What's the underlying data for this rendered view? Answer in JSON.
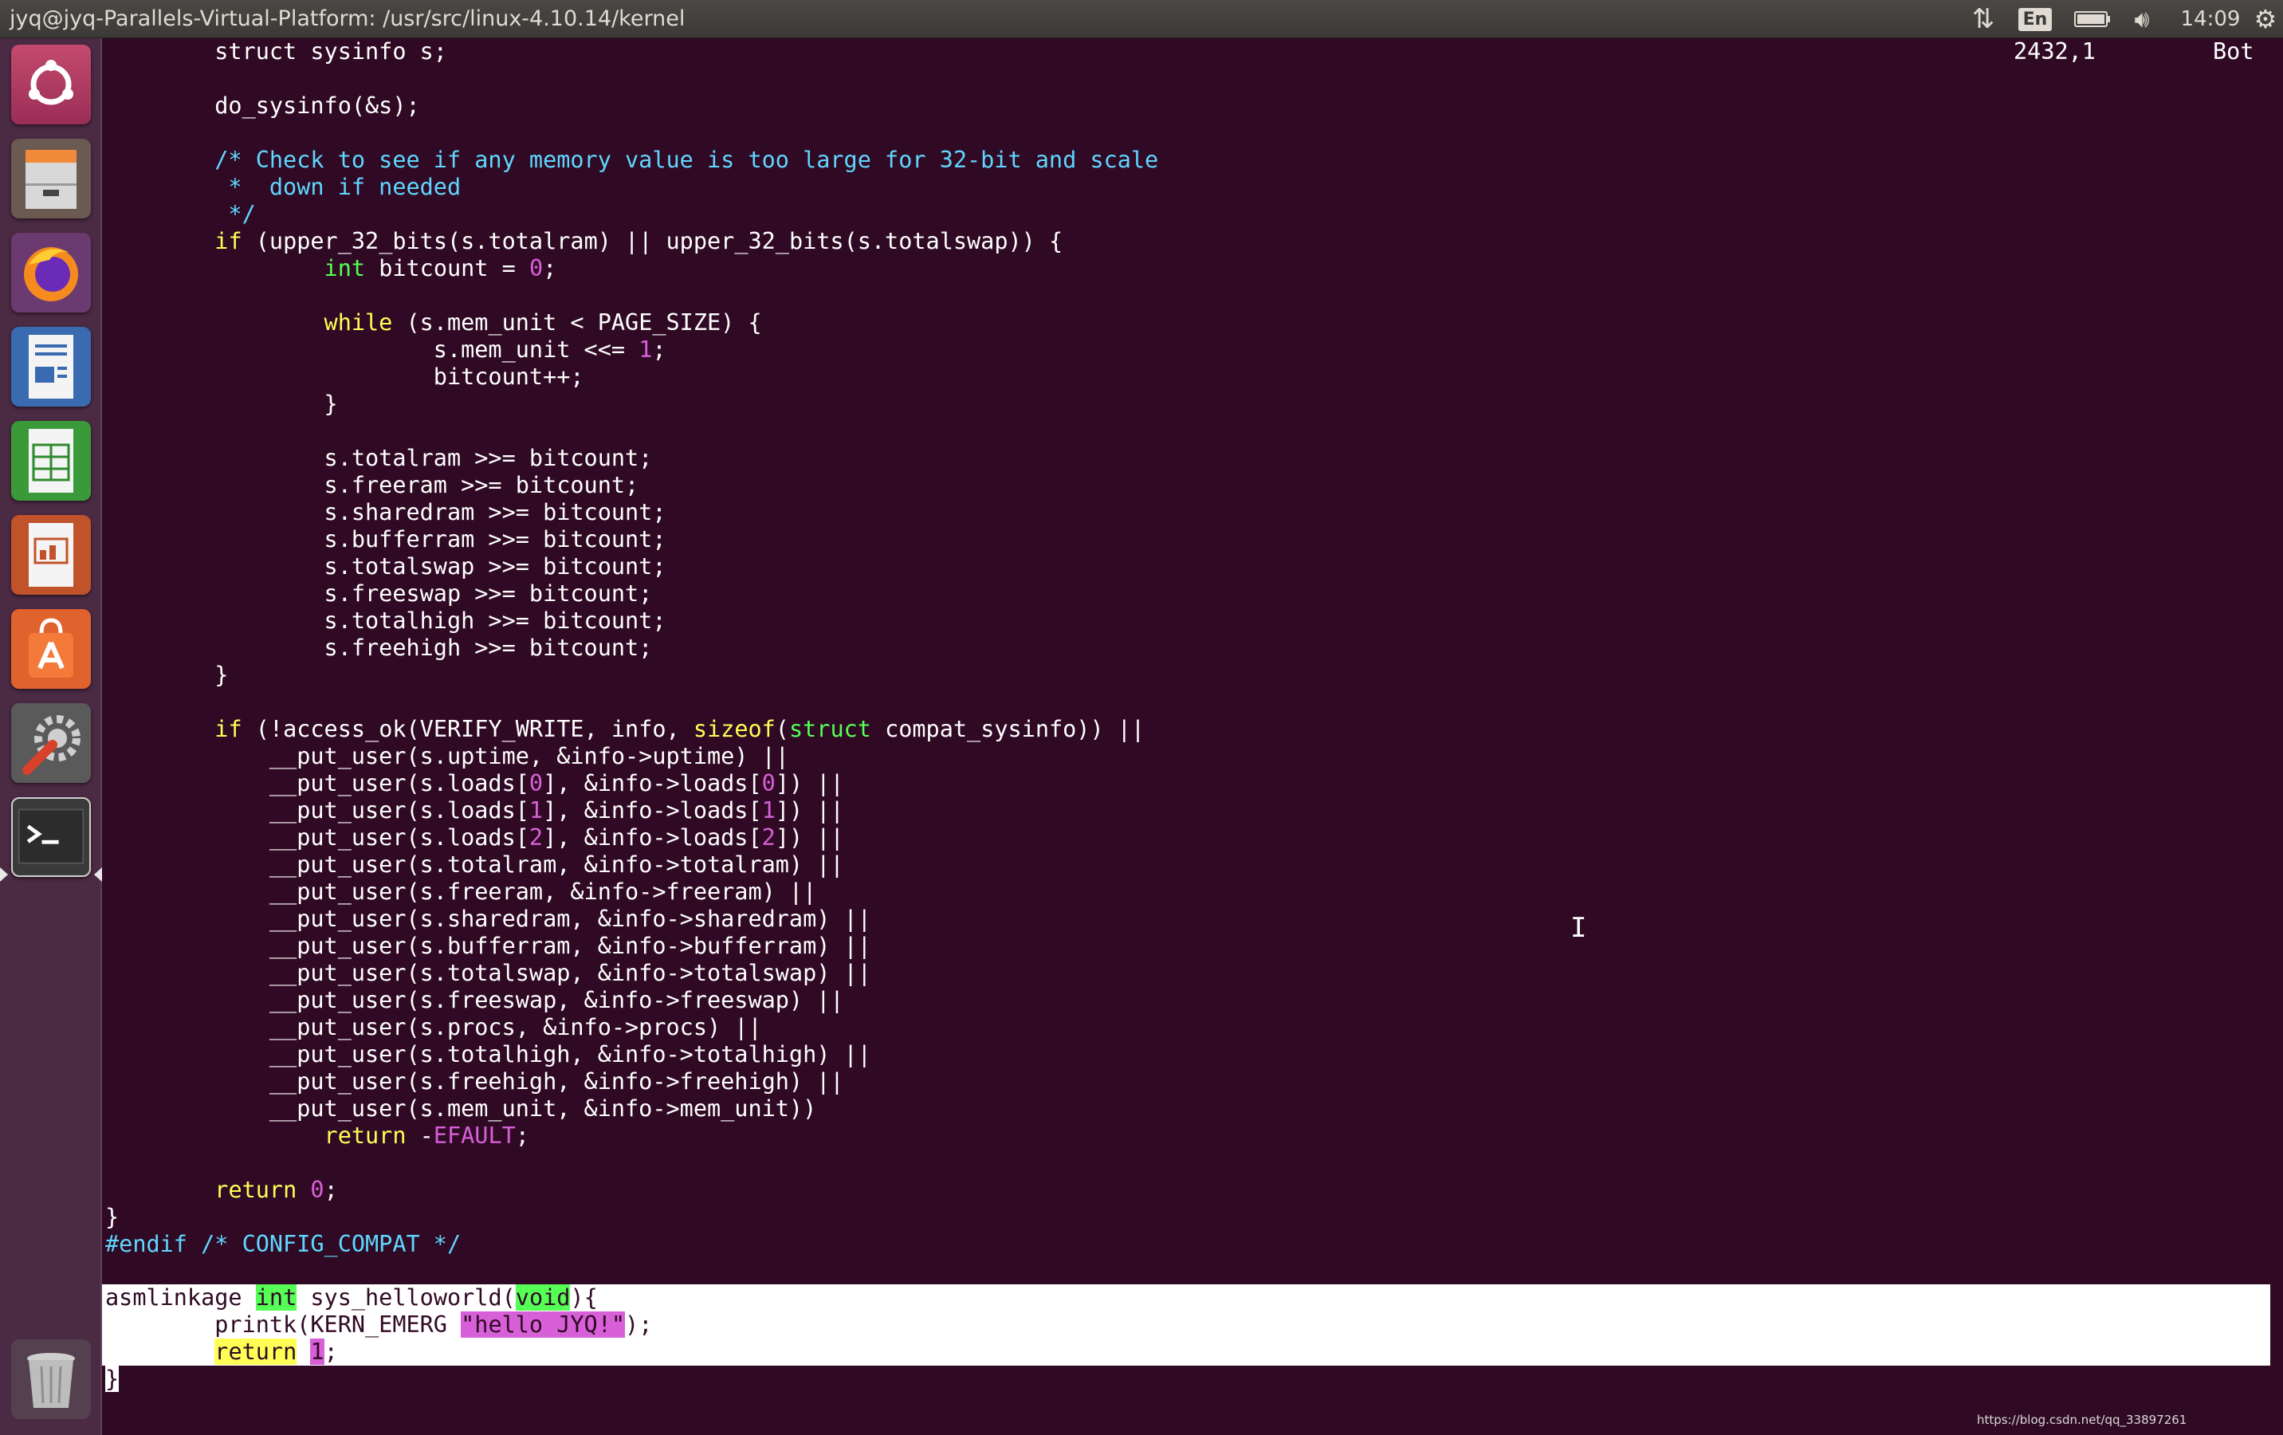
{
  "window_title": "jyq@jyq-Parallels-Virtual-Platform: /usr/src/linux-4.10.14/kernel",
  "panel": {
    "language": "En",
    "time": "14:09",
    "icons": [
      "network-updown-icon",
      "battery-icon",
      "volume-icon",
      "settings-gear-icon"
    ]
  },
  "launcher": {
    "items": [
      {
        "name": "ubuntu-dash",
        "icon": "ubuntu-logo-icon"
      },
      {
        "name": "files",
        "icon": "file-cabinet-icon"
      },
      {
        "name": "firefox",
        "icon": "firefox-icon"
      },
      {
        "name": "libreoffice-writer",
        "icon": "writer-icon"
      },
      {
        "name": "libreoffice-calc",
        "icon": "calc-icon"
      },
      {
        "name": "libreoffice-impress",
        "icon": "impress-icon"
      },
      {
        "name": "software-center",
        "icon": "shopping-bag-icon"
      },
      {
        "name": "system-settings",
        "icon": "wrench-gear-icon"
      },
      {
        "name": "terminal",
        "icon": "terminal-icon",
        "active": true
      },
      {
        "name": "trash",
        "icon": "trash-icon"
      }
    ]
  },
  "code_lines": [
    [
      {
        "t": "        struct sysinfo s;"
      }
    ],
    [
      {
        "t": ""
      }
    ],
    [
      {
        "t": "        do_sysinfo(&s);"
      }
    ],
    [
      {
        "t": ""
      }
    ],
    [
      {
        "t": "        /* Check to see if any memory value is too large for 32-bit and scale",
        "c": "cm"
      }
    ],
    [
      {
        "t": "         *  down if needed",
        "c": "cm"
      }
    ],
    [
      {
        "t": "         */",
        "c": "cm"
      }
    ],
    [
      {
        "t": "        "
      },
      {
        "t": "if",
        "c": "kw"
      },
      {
        "t": " (upper_32_bits(s.totalram) || upper_32_bits(s.totalswap)) {"
      }
    ],
    [
      {
        "t": "                "
      },
      {
        "t": "int",
        "c": "tp"
      },
      {
        "t": " bitcount = "
      },
      {
        "t": "0",
        "c": "nm"
      },
      {
        "t": ";"
      }
    ],
    [
      {
        "t": ""
      }
    ],
    [
      {
        "t": "                "
      },
      {
        "t": "while",
        "c": "kw"
      },
      {
        "t": " (s.mem_unit < PAGE_SIZE) {"
      }
    ],
    [
      {
        "t": "                        s.mem_unit <<= "
      },
      {
        "t": "1",
        "c": "nm"
      },
      {
        "t": ";"
      }
    ],
    [
      {
        "t": "                        bitcount++;"
      }
    ],
    [
      {
        "t": "                }"
      }
    ],
    [
      {
        "t": ""
      }
    ],
    [
      {
        "t": "                s.totalram >>= bitcount;"
      }
    ],
    [
      {
        "t": "                s.freeram >>= bitcount;"
      }
    ],
    [
      {
        "t": "                s.sharedram >>= bitcount;"
      }
    ],
    [
      {
        "t": "                s.bufferram >>= bitcount;"
      }
    ],
    [
      {
        "t": "                s.totalswap >>= bitcount;"
      }
    ],
    [
      {
        "t": "                s.freeswap >>= bitcount;"
      }
    ],
    [
      {
        "t": "                s.totalhigh >>= bitcount;"
      }
    ],
    [
      {
        "t": "                s.freehigh >>= bitcount;"
      }
    ],
    [
      {
        "t": "        }"
      }
    ],
    [
      {
        "t": ""
      }
    ],
    [
      {
        "t": "        "
      },
      {
        "t": "if",
        "c": "kw"
      },
      {
        "t": " (!access_ok(VERIFY_WRITE, info, "
      },
      {
        "t": "sizeof",
        "c": "sz"
      },
      {
        "t": "("
      },
      {
        "t": "struct",
        "c": "tp"
      },
      {
        "t": " compat_sysinfo)) ||"
      }
    ],
    [
      {
        "t": "            __put_user(s.uptime, &info->uptime) ||"
      }
    ],
    [
      {
        "t": "            __put_user(s.loads["
      },
      {
        "t": "0",
        "c": "nm"
      },
      {
        "t": "], &info->loads["
      },
      {
        "t": "0",
        "c": "nm"
      },
      {
        "t": "]) ||"
      }
    ],
    [
      {
        "t": "            __put_user(s.loads["
      },
      {
        "t": "1",
        "c": "nm"
      },
      {
        "t": "], &info->loads["
      },
      {
        "t": "1",
        "c": "nm"
      },
      {
        "t": "]) ||"
      }
    ],
    [
      {
        "t": "            __put_user(s.loads["
      },
      {
        "t": "2",
        "c": "nm"
      },
      {
        "t": "], &info->loads["
      },
      {
        "t": "2",
        "c": "nm"
      },
      {
        "t": "]) ||"
      }
    ],
    [
      {
        "t": "            __put_user(s.totalram, &info->totalram) ||"
      }
    ],
    [
      {
        "t": "            __put_user(s.freeram, &info->freeram) ||"
      }
    ],
    [
      {
        "t": "            __put_user(s.sharedram, &info->sharedram) ||"
      }
    ],
    [
      {
        "t": "            __put_user(s.bufferram, &info->bufferram) ||"
      }
    ],
    [
      {
        "t": "            __put_user(s.totalswap, &info->totalswap) ||"
      }
    ],
    [
      {
        "t": "            __put_user(s.freeswap, &info->freeswap) ||"
      }
    ],
    [
      {
        "t": "            __put_user(s.procs, &info->procs) ||"
      }
    ],
    [
      {
        "t": "            __put_user(s.totalhigh, &info->totalhigh) ||"
      }
    ],
    [
      {
        "t": "            __put_user(s.freehigh, &info->freehigh) ||"
      }
    ],
    [
      {
        "t": "            __put_user(s.mem_unit, &info->mem_unit))"
      }
    ],
    [
      {
        "t": "                "
      },
      {
        "t": "return",
        "c": "kw"
      },
      {
        "t": " -"
      },
      {
        "t": "EFAULT",
        "c": "nm"
      },
      {
        "t": ";"
      }
    ],
    [
      {
        "t": ""
      }
    ],
    [
      {
        "t": "        "
      },
      {
        "t": "return",
        "c": "kw"
      },
      {
        "t": " "
      },
      {
        "t": "0",
        "c": "nm"
      },
      {
        "t": ";"
      }
    ],
    [
      {
        "t": "}"
      }
    ],
    [
      {
        "t": "#endif /* CONFIG_COMPAT */",
        "c": "pp"
      }
    ],
    [
      {
        "t": ""
      }
    ]
  ],
  "selected_lines": [
    [
      {
        "t": "asmlinkage "
      },
      {
        "t": "int",
        "c": "hl-type"
      },
      {
        "t": " sys_helloworld("
      },
      {
        "t": "void",
        "c": "hl-type"
      },
      {
        "t": "){"
      }
    ],
    [
      {
        "t": "        printk(KERN_EMERG "
      },
      {
        "t": "\"hello JYQ!\"",
        "c": "hl-str"
      },
      {
        "t": ");"
      }
    ],
    [
      {
        "t": "        "
      },
      {
        "t": "return",
        "c": "hl-kw"
      },
      {
        "t": " "
      },
      {
        "t": "1",
        "c": "hl-str"
      },
      {
        "t": ";"
      }
    ]
  ],
  "cursor_line": [
    {
      "t": "}",
      "c": "cursor"
    }
  ],
  "status": {
    "position": "2432,1",
    "scroll": "Bot"
  },
  "watermark": "https://blog.csdn.net/qq_33897261",
  "colors": {
    "terminal_bg": "#300a24",
    "keyword": "#ffff55",
    "type": "#55ff55",
    "comment": "#5fd7ff",
    "number": "#d75fd7",
    "launcher_bg": "#4b2a44"
  }
}
